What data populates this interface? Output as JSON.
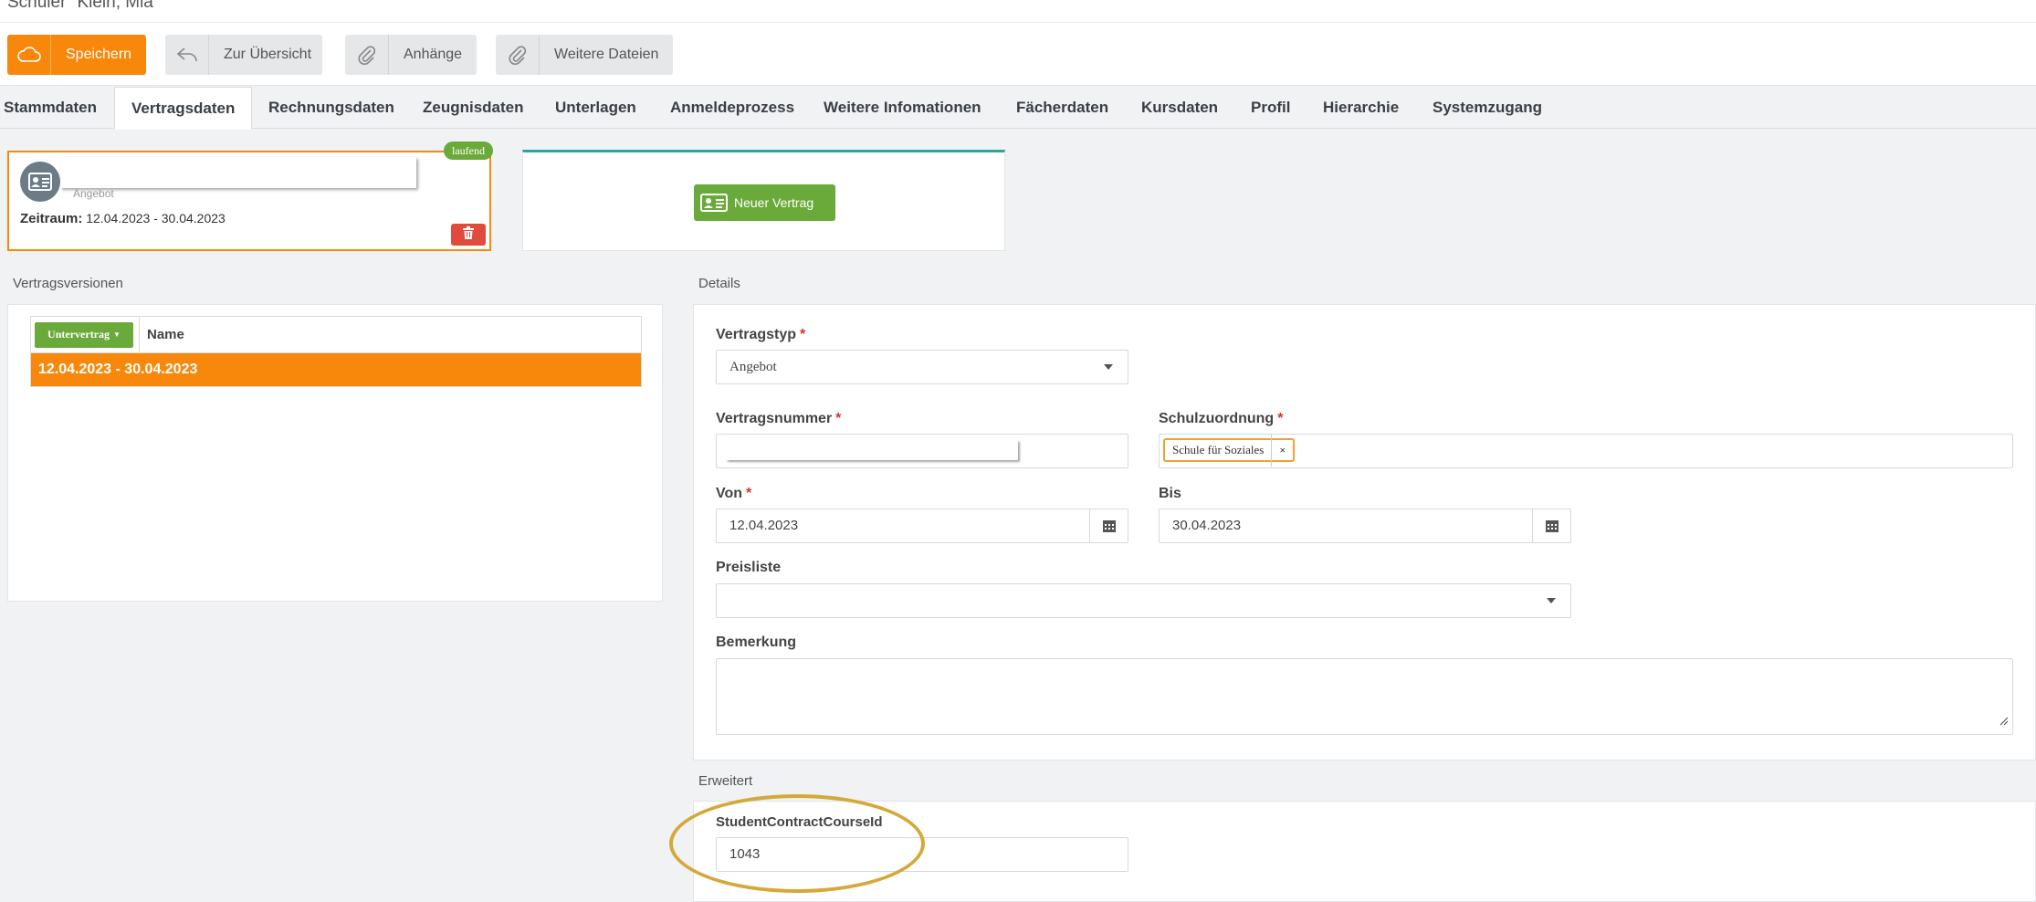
{
  "page": {
    "title": "Schüler \"Klein, Mia\""
  },
  "toolbar": {
    "save_label": "Speichern",
    "overview_label": "Zur Übersicht",
    "attachments_label": "Anhänge",
    "more_files_label": "Weitere Dateien"
  },
  "tabs": [
    {
      "label": "Stammdaten"
    },
    {
      "label": "Vertragsdaten"
    },
    {
      "label": "Rechnungsdaten"
    },
    {
      "label": "Zeugnisdaten"
    },
    {
      "label": "Unterlagen"
    },
    {
      "label": "Anmeldeprozess"
    },
    {
      "label": "Weitere Infomationen"
    },
    {
      "label": "Fächerdaten"
    },
    {
      "label": "Kursdaten"
    },
    {
      "label": "Profil"
    },
    {
      "label": "Hierarchie"
    },
    {
      "label": "Systemzugang"
    }
  ],
  "active_tab": "Vertragsdaten",
  "contract_card": {
    "type": "Angebot",
    "period_label": "Zeitraum:",
    "period_value": "12.04.2023 - 30.04.2023",
    "status_badge": "laufend"
  },
  "new_contract": {
    "label": "Neuer Vertrag"
  },
  "versions": {
    "section_label": "Vertragsversionen",
    "sub_contract_button": "Untervertrag",
    "column_name": "Name",
    "rows": [
      {
        "name": "12.04.2023 - 30.04.2023"
      }
    ]
  },
  "details": {
    "section_label": "Details",
    "contract_type": {
      "label": "Vertragstyp",
      "value": "Angebot"
    },
    "contract_number": {
      "label": "Vertragsnummer",
      "value": ""
    },
    "school": {
      "label": "Schulzuordnung",
      "tag": "Schule für Soziales",
      "remove": "×"
    },
    "from": {
      "label": "Von",
      "value": "12.04.2023"
    },
    "to": {
      "label": "Bis",
      "value": "30.04.2023"
    },
    "price_list": {
      "label": "Preisliste",
      "value": ""
    },
    "remark": {
      "label": "Bemerkung",
      "value": ""
    },
    "required_marker": "*"
  },
  "extended": {
    "section_label": "Erweitert",
    "course_id": {
      "label": "StudentContractCourseId",
      "value": "1043"
    }
  },
  "colors": {
    "accent_orange": "#f7880b",
    "success_green": "#6aaa3a",
    "danger_red": "#e04b3c",
    "highlight_gold": "#d4a93a",
    "teal_border": "#29a89a"
  }
}
